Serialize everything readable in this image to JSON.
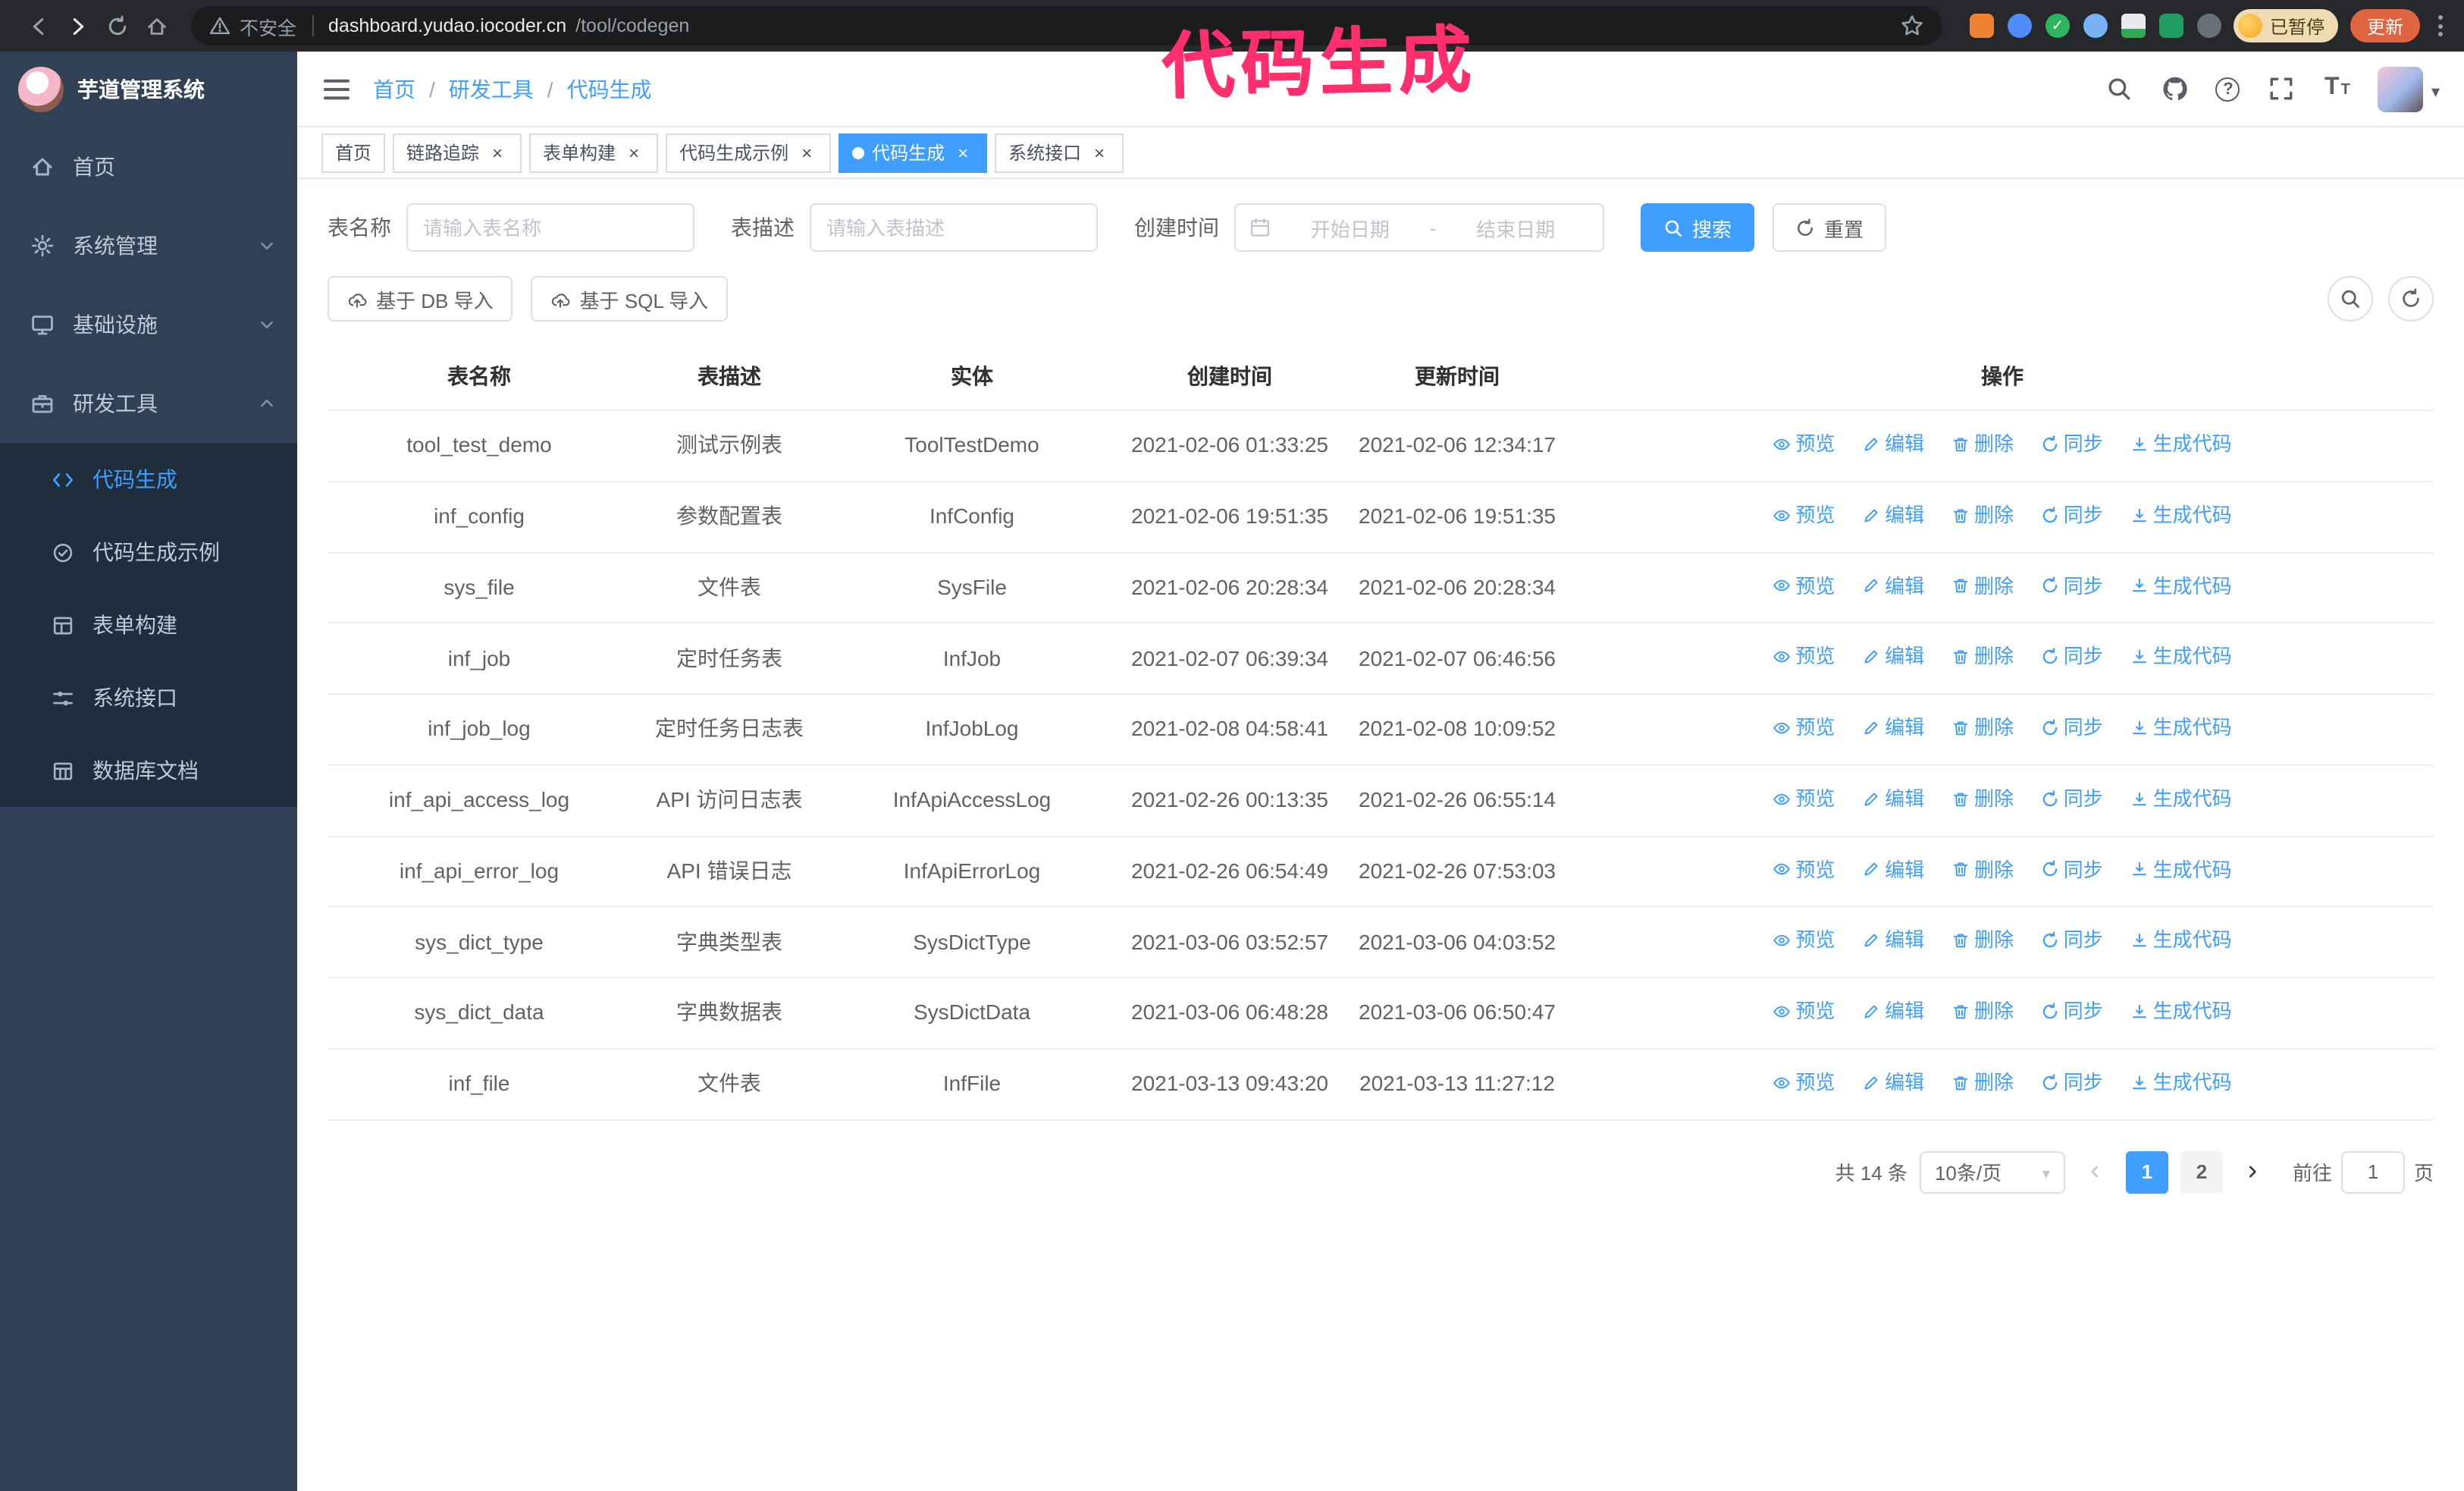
{
  "colors": {
    "accent": "#409eff",
    "annotation": "#ff2f6d",
    "sidebar_bg": "#304156",
    "submenu_bg": "#1f2d3d",
    "update_button_bg": "#e0643f"
  },
  "browser": {
    "security_label": "不安全",
    "url_domain": "dashboard.yudao.iocoder.cn",
    "url_path": "/tool/codegen",
    "paused_badge": "已暂停",
    "update_button": "更新"
  },
  "annotation": {
    "text": "代码生成"
  },
  "sidebar": {
    "logo_title": "芋道管理系统",
    "items": [
      {
        "label": "首页"
      },
      {
        "label": "系统管理",
        "chevron": "down"
      },
      {
        "label": "基础设施",
        "chevron": "down"
      },
      {
        "label": "研发工具",
        "chevron": "up",
        "expanded": true
      }
    ],
    "subitems": [
      {
        "label": "代码生成",
        "active": true
      },
      {
        "label": "代码生成示例"
      },
      {
        "label": "表单构建"
      },
      {
        "label": "系统接口"
      },
      {
        "label": "数据库文档"
      }
    ]
  },
  "header": {
    "breadcrumb": [
      "首页",
      "研发工具",
      "代码生成"
    ]
  },
  "tabs": [
    {
      "label": "首页",
      "closable": false,
      "active": false
    },
    {
      "label": "链路追踪",
      "closable": true,
      "active": false
    },
    {
      "label": "表单构建",
      "closable": true,
      "active": false
    },
    {
      "label": "代码生成示例",
      "closable": true,
      "active": false
    },
    {
      "label": "代码生成",
      "closable": true,
      "active": true
    },
    {
      "label": "系统接口",
      "closable": true,
      "active": false
    }
  ],
  "filters": {
    "name_label": "表名称",
    "name_placeholder": "请输入表名称",
    "desc_label": "表描述",
    "desc_placeholder": "请输入表描述",
    "time_label": "创建时间",
    "start_placeholder": "开始日期",
    "range_separator": "-",
    "end_placeholder": "结束日期",
    "search_button": "搜索",
    "reset_button": "重置"
  },
  "toolbar": {
    "import_db": "基于 DB 导入",
    "import_sql": "基于 SQL 导入"
  },
  "table": {
    "columns": [
      "表名称",
      "表描述",
      "实体",
      "创建时间",
      "更新时间",
      "操作"
    ],
    "actions": [
      "预览",
      "编辑",
      "删除",
      "同步",
      "生成代码"
    ],
    "rows": [
      {
        "name": "tool_test_demo",
        "desc": "测试示例表",
        "entity": "ToolTestDemo",
        "created": "2021-02-06 01:33:25",
        "updated": "2021-02-06 12:34:17"
      },
      {
        "name": "inf_config",
        "desc": "参数配置表",
        "entity": "InfConfig",
        "created": "2021-02-06 19:51:35",
        "updated": "2021-02-06 19:51:35"
      },
      {
        "name": "sys_file",
        "desc": "文件表",
        "entity": "SysFile",
        "created": "2021-02-06 20:28:34",
        "updated": "2021-02-06 20:28:34"
      },
      {
        "name": "inf_job",
        "desc": "定时任务表",
        "entity": "InfJob",
        "created": "2021-02-07 06:39:34",
        "updated": "2021-02-07 06:46:56"
      },
      {
        "name": "inf_job_log",
        "desc": "定时任务日志表",
        "entity": "InfJobLog",
        "created": "2021-02-08 04:58:41",
        "updated": "2021-02-08 10:09:52"
      },
      {
        "name": "inf_api_access_log",
        "desc": "API 访问日志表",
        "entity": "InfApiAccessLog",
        "created": "2021-02-26 00:13:35",
        "updated": "2021-02-26 06:55:14"
      },
      {
        "name": "inf_api_error_log",
        "desc": "API 错误日志",
        "entity": "InfApiErrorLog",
        "created": "2021-02-26 06:54:49",
        "updated": "2021-02-26 07:53:03"
      },
      {
        "name": "sys_dict_type",
        "desc": "字典类型表",
        "entity": "SysDictType",
        "created": "2021-03-06 03:52:57",
        "updated": "2021-03-06 04:03:52"
      },
      {
        "name": "sys_dict_data",
        "desc": "字典数据表",
        "entity": "SysDictData",
        "created": "2021-03-06 06:48:28",
        "updated": "2021-03-06 06:50:47"
      },
      {
        "name": "inf_file",
        "desc": "文件表",
        "entity": "InfFile",
        "created": "2021-03-13 09:43:20",
        "updated": "2021-03-13 11:27:12"
      }
    ]
  },
  "pagination": {
    "total": "共 14 条",
    "page_size": "10条/页",
    "pages": [
      "1",
      "2"
    ],
    "active_page": "1",
    "goto_label": "前往",
    "goto_value": "1",
    "page_suffix": "页"
  }
}
